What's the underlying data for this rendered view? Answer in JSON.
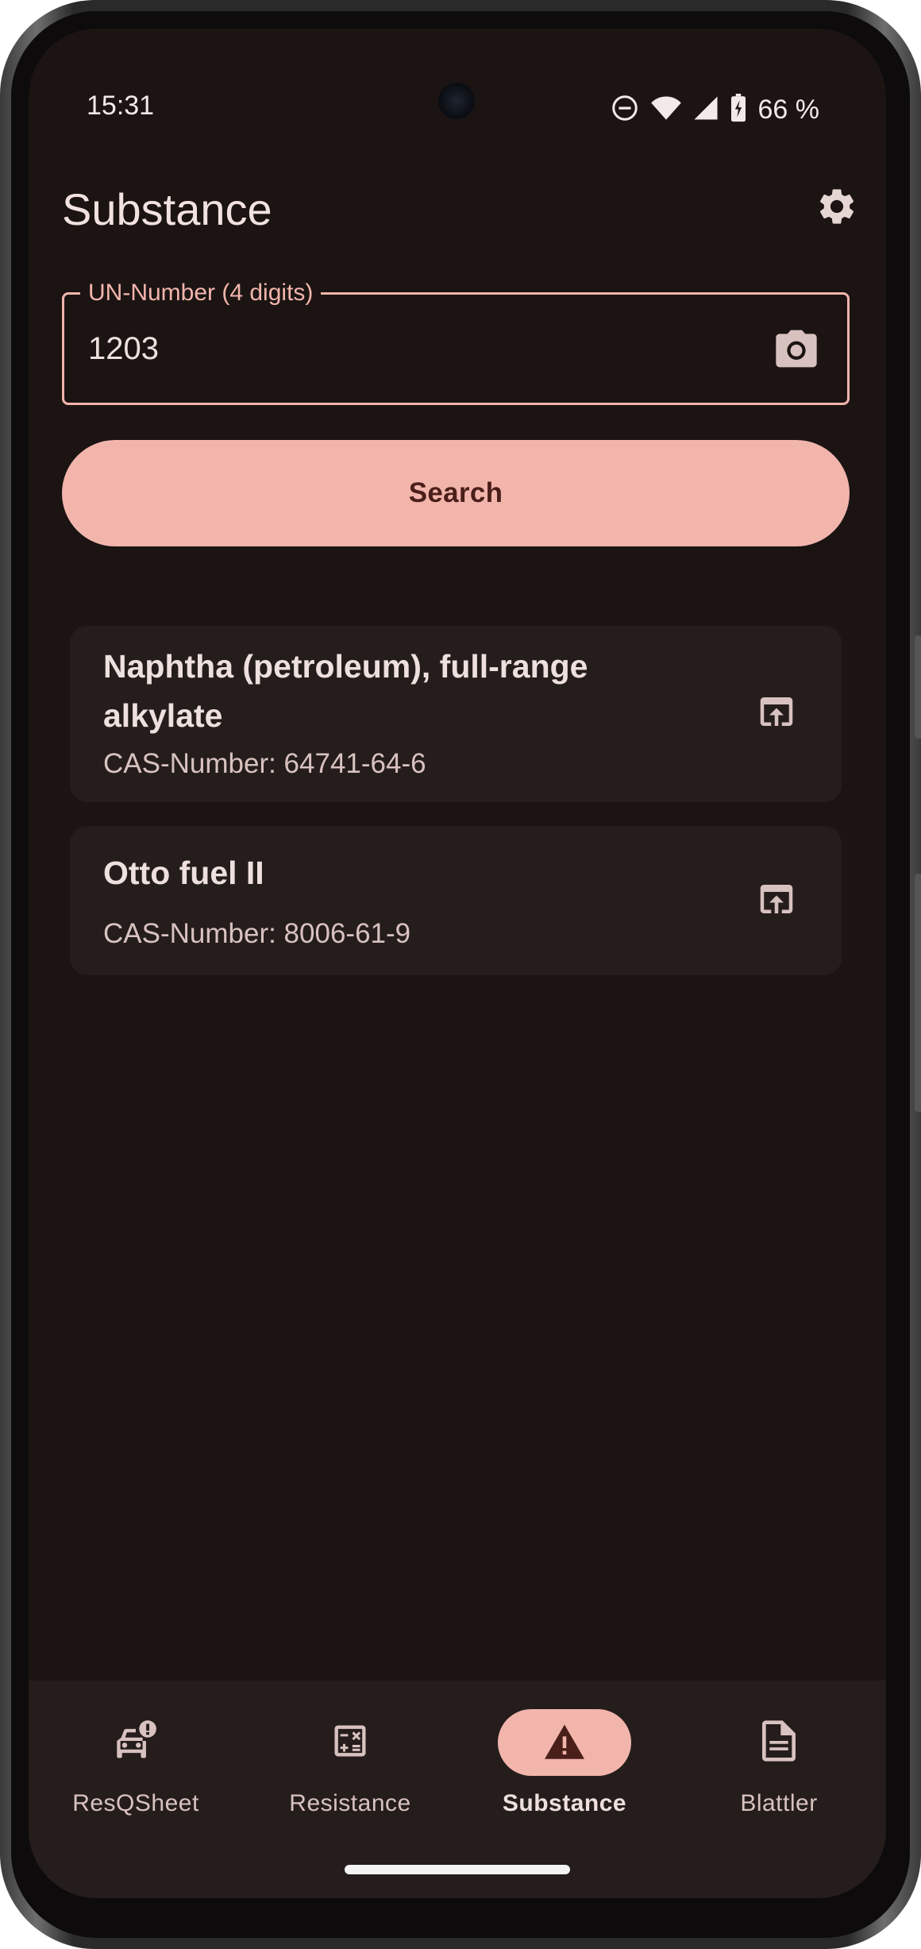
{
  "status_bar": {
    "time": "15:31",
    "battery_percent": "66 %",
    "icons": [
      "do-not-disturb-icon",
      "wifi-icon",
      "cell-signal-icon",
      "battery-charging-icon"
    ]
  },
  "header": {
    "title": "Substance",
    "settings_icon": "gear-icon"
  },
  "un_field": {
    "label": "UN-Number (4 digits)",
    "value": "1203",
    "trailing_icon": "camera-icon"
  },
  "search_button": {
    "label": "Search"
  },
  "results": [
    {
      "name": "Naphtha (petroleum), full-range alkylate",
      "cas": "CAS-Number: 64741-64-6",
      "action_icon": "open-in-browser-icon"
    },
    {
      "name": "Otto fuel II",
      "cas": "CAS-Number: 8006-61-9",
      "action_icon": "open-in-browser-icon"
    }
  ],
  "bottom_nav": {
    "items": [
      {
        "label": "ResQSheet",
        "icon": "car-alert-icon",
        "active": false
      },
      {
        "label": "Resistance",
        "icon": "calculator-icon",
        "active": false
      },
      {
        "label": "Substance",
        "icon": "warning-triangle-icon",
        "active": true
      },
      {
        "label": "Blattler",
        "icon": "document-icon",
        "active": false
      }
    ]
  },
  "colors": {
    "background": "#1b1413",
    "surface": "#251d1c",
    "primary": "#f2b5ac",
    "on_primary": "#4a1f1a",
    "on_surface": "#ede0de"
  }
}
